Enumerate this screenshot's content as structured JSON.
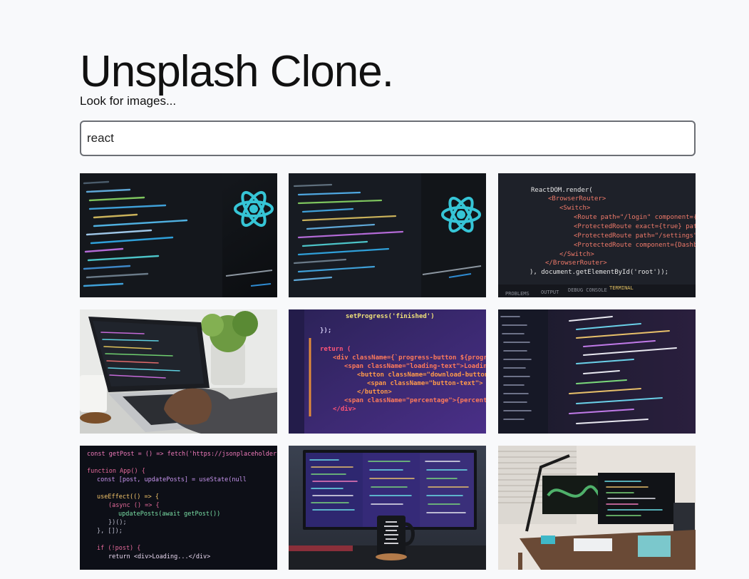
{
  "header": {
    "title": "Unsplash Clone.",
    "search_label": "Look for images..."
  },
  "search": {
    "value": "react"
  },
  "results": [
    {
      "id": "tile-1",
      "desc": "React code on screen with logo"
    },
    {
      "id": "tile-2",
      "desc": "React code on screen with logo"
    },
    {
      "id": "tile-3",
      "desc": "ReactDOM render code in editor"
    },
    {
      "id": "tile-4",
      "desc": "Laptop with code and plant"
    },
    {
      "id": "tile-5",
      "desc": "Progress button JSX code"
    },
    {
      "id": "tile-6",
      "desc": "Editor with file tree"
    },
    {
      "id": "tile-7",
      "desc": "getPost fetch code"
    },
    {
      "id": "tile-8",
      "desc": "Monitor with code and mug"
    },
    {
      "id": "tile-9",
      "desc": "Desk setup with monitors"
    }
  ],
  "image_text": {
    "t3": [
      "ReactDOM.render(",
      "<BrowserRouter>",
      "<Switch>",
      "<Route path=\"/login\" component={Login} />",
      "<ProtectedRoute exact={true} path=\"/\" co",
      "<ProtectedRoute path=\"/settings\" compone",
      "<ProtectedRoute component={Dashboard} />",
      "</Switch>",
      "</BrowserRouter>",
      "), document.getElementById('root'));",
      "PROBLEMS",
      "OUTPUT",
      "DEBUG CONSOLE",
      "TERMINAL"
    ],
    "t5": [
      "setProgress('finished')",
      "});",
      "return (",
      "<div className={`progress-button ${progress}`}>",
      "<span className=\"loading-text\">Loading...</span>",
      "<button className=\"download-button\">",
      "<span className=\"button-text\">",
      "</button>",
      "<span className=\"percentage\">{percentage}</span>",
      "</div>"
    ],
    "t7": [
      "const getPost = () => fetch('https://jsonplaceholder.typicode",
      "function App() {",
      "const [post, updatePosts] = useState(null",
      "useEffect(() => {",
      "(async () => {",
      "updatePosts(await getPost())",
      "})();",
      "}, []);",
      "if (!post) {",
      "return <div>Loading...</div>"
    ]
  }
}
